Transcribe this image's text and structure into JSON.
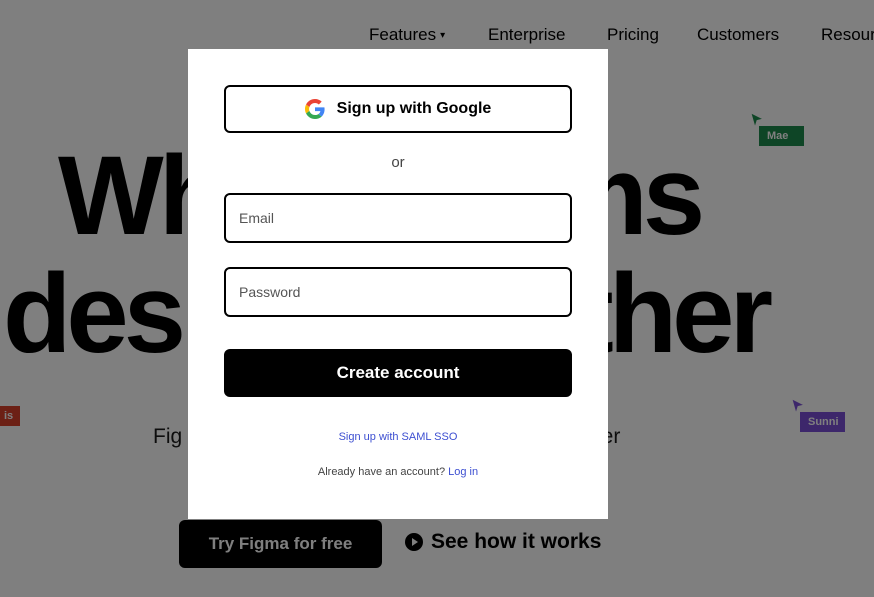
{
  "nav": {
    "items": [
      {
        "label": "Features",
        "has_dropdown": true
      },
      {
        "label": "Enterprise"
      },
      {
        "label": "Pricing"
      },
      {
        "label": "Customers"
      },
      {
        "label": "Resour"
      }
    ],
    "caret": "▾"
  },
  "hero": {
    "line1": "Where teams",
    "line2": "design together",
    "subhead_start": "Fig",
    "subhead_end": "tter"
  },
  "cta": {
    "try_label": "Try Figma for free",
    "see_label": "See how it works"
  },
  "cursors": [
    {
      "name": "Mae",
      "color": "#1c8a4c"
    },
    {
      "name": "Sunni",
      "color": "#7b4fd6"
    },
    {
      "name": "is",
      "color": "#d9402a"
    }
  ],
  "modal": {
    "google_label": "Sign up with Google",
    "or_text": "or",
    "email_placeholder": "Email",
    "password_placeholder": "Password",
    "create_label": "Create account",
    "sso_label": "Sign up with SAML SSO",
    "login_prompt": "Already have an account?",
    "login_label": "Log in"
  },
  "colors": {
    "overlay": "rgba(0,0,0,0.5)",
    "link": "#3d4fd1",
    "button_bg": "#000000"
  }
}
